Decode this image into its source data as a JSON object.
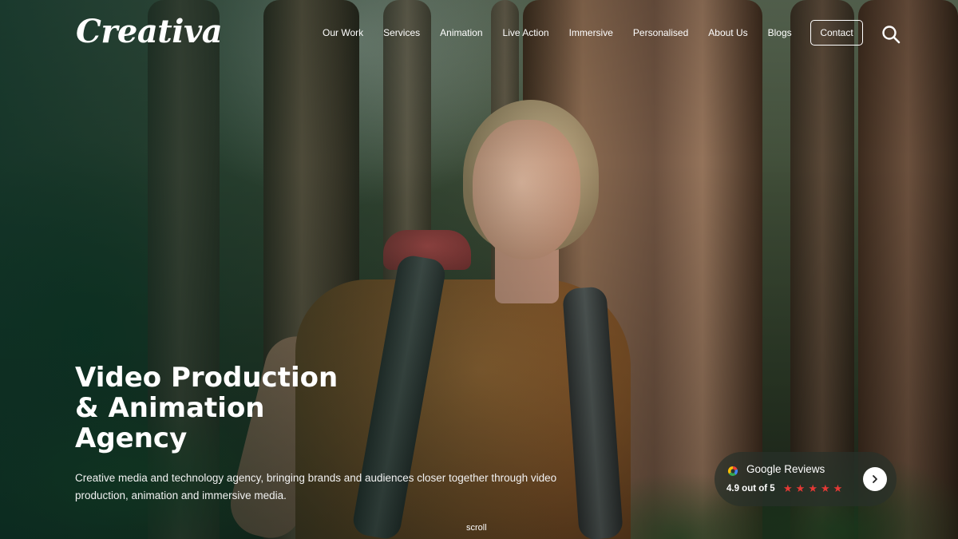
{
  "brand": {
    "logo_text": "Creativa"
  },
  "nav": {
    "items": [
      {
        "label": "Our Work"
      },
      {
        "label": "Services"
      },
      {
        "label": "Animation"
      },
      {
        "label": "Live Action"
      },
      {
        "label": "Immersive"
      },
      {
        "label": "Personalised"
      },
      {
        "label": "About Us"
      },
      {
        "label": "Blogs"
      }
    ],
    "contact_label": "Contact",
    "search_icon": "search-icon"
  },
  "hero": {
    "headline_lines": [
      "Video Production",
      "& Animation",
      "Agency"
    ],
    "subtext": "Creative media and technology agency, bringing brands and audiences closer together through video production, animation and immersive media.",
    "scroll_label": "scroll"
  },
  "reviews": {
    "title": "Google Reviews",
    "score": "4.9 out of 5",
    "rating": 5,
    "max_rating": 5,
    "star_color": "#e53935",
    "arrow_icon": "chevron-right-icon"
  }
}
